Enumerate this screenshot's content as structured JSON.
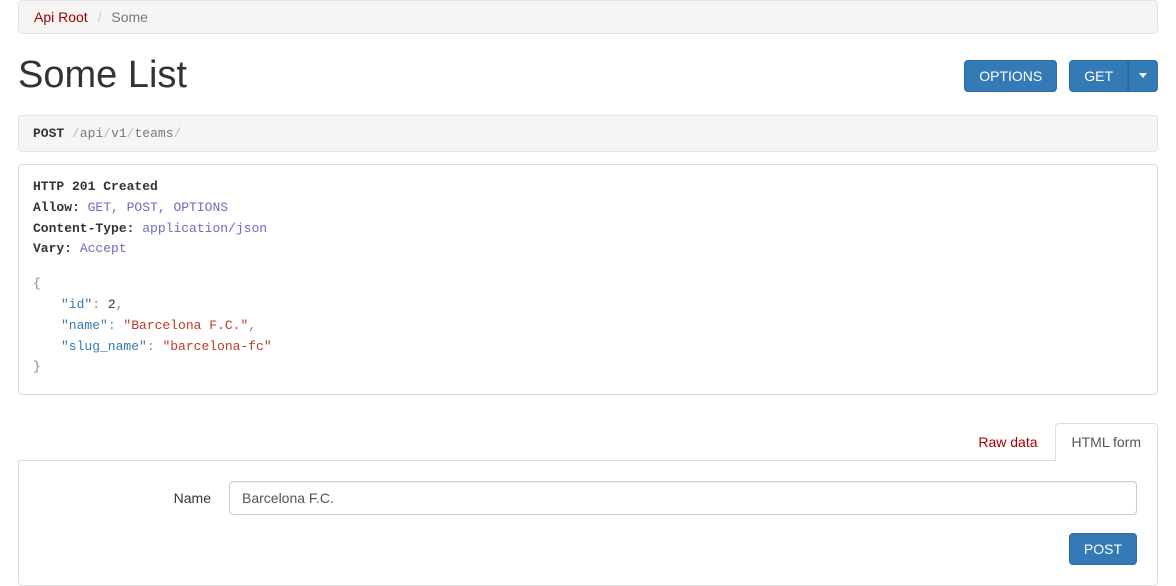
{
  "breadcrumb": {
    "root": "Api Root",
    "current": "Some"
  },
  "header": {
    "title": "Some List",
    "options_btn": "OPTIONS",
    "get_btn": "GET"
  },
  "request": {
    "method": "POST",
    "path_parts": [
      "api",
      "v1",
      "teams"
    ]
  },
  "response": {
    "status_line": "HTTP 201 Created",
    "headers": {
      "allow_key": "Allow:",
      "allow_val": "GET, POST, OPTIONS",
      "ctype_key": "Content-Type:",
      "ctype_val": "application/json",
      "vary_key": "Vary:",
      "vary_val": "Accept"
    },
    "body": {
      "id_key": "\"id\"",
      "id_val": "2",
      "name_key": "\"name\"",
      "name_val": "\"Barcelona F.C.\"",
      "slug_key": "\"slug_name\"",
      "slug_val": "\"barcelona-fc\""
    }
  },
  "tabs": {
    "raw": "Raw data",
    "html": "HTML form"
  },
  "form": {
    "name_label": "Name",
    "name_value": "Barcelona F.C.",
    "post_btn": "POST"
  }
}
